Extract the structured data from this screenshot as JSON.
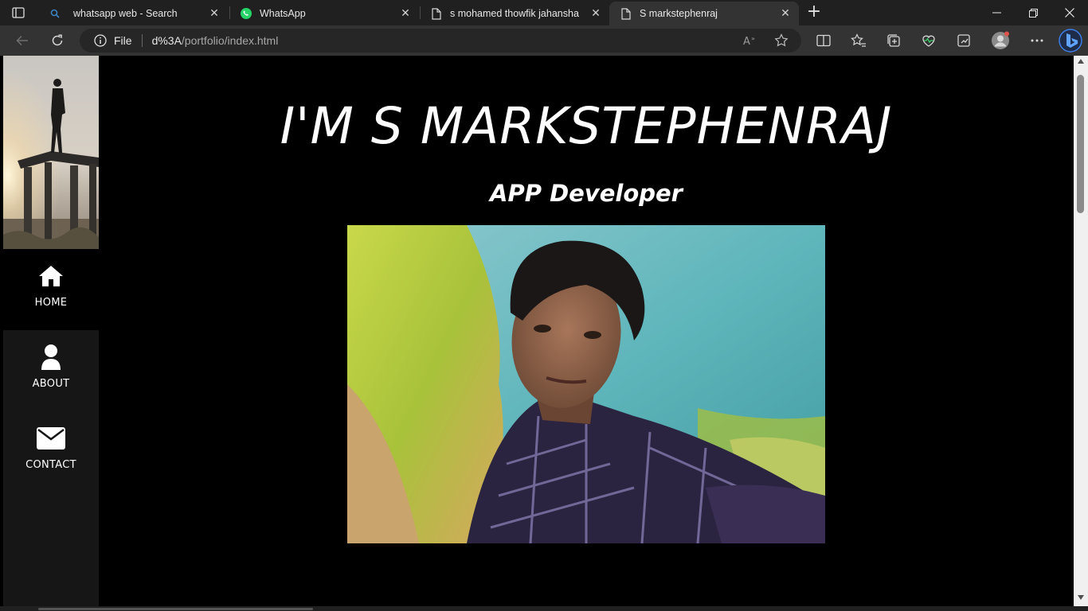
{
  "browser": {
    "tabs": [
      {
        "title": "whatsapp web - Search",
        "icon": "search-icon",
        "active": false
      },
      {
        "title": "WhatsApp",
        "icon": "whatsapp-icon",
        "active": false
      },
      {
        "title": "s mohamed thowfik jahansha",
        "icon": "document-icon",
        "active": false
      },
      {
        "title": "S markstephenraj",
        "icon": "document-icon",
        "active": true
      }
    ],
    "address": {
      "scheme_label": "File",
      "url_host": "d%3A",
      "url_path": "/portfolio/index.html"
    },
    "colors": {
      "tabbar": "#202020",
      "toolbar": "#333333",
      "whatsapp": "#25D366",
      "bing": "#1a73e8"
    }
  },
  "page": {
    "sidebar": {
      "items": [
        {
          "label": "HOME",
          "icon": "home-icon",
          "active": true
        },
        {
          "label": "ABOUT",
          "icon": "user-icon",
          "active": false
        },
        {
          "label": "CONTACT",
          "icon": "envelope-icon",
          "active": false
        }
      ]
    },
    "hero": {
      "title": "I'M S MARKSTEPHENRAJ",
      "subtitle": "APP Developer"
    }
  }
}
